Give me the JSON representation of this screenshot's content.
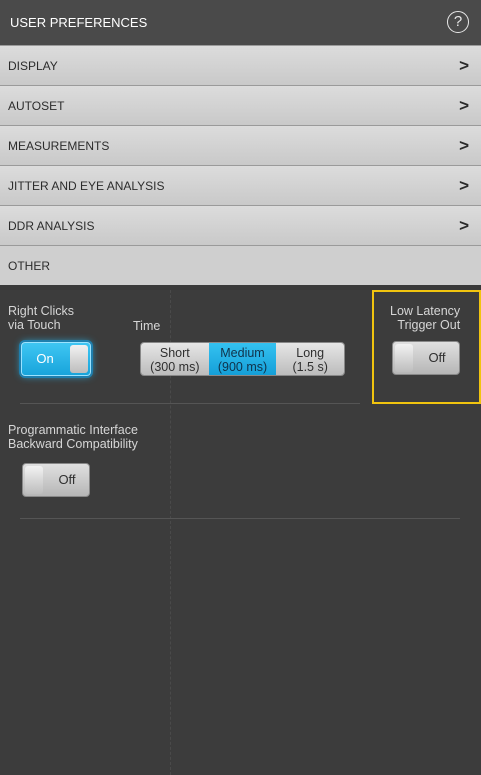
{
  "header": {
    "title": "USER PREFERENCES",
    "help_icon": "?"
  },
  "sections": [
    {
      "label": "DISPLAY",
      "expanded": false
    },
    {
      "label": "AUTOSET",
      "expanded": false
    },
    {
      "label": "MEASUREMENTS",
      "expanded": false
    },
    {
      "label": "JITTER AND EYE ANALYSIS",
      "expanded": false
    },
    {
      "label": "DDR ANALYSIS",
      "expanded": false
    },
    {
      "label": "OTHER",
      "expanded": true
    }
  ],
  "chevron": ">",
  "other": {
    "right_clicks": {
      "label_line1": "Right Clicks",
      "label_line2": "via Touch",
      "toggle_value": "On"
    },
    "time": {
      "label": "Time",
      "options": [
        {
          "line1": "Short",
          "line2": "(300 ms)",
          "selected": false
        },
        {
          "line1": "Medium",
          "line2": "(900 ms)",
          "selected": true
        },
        {
          "line1": "Long",
          "line2": "(1.5 s)",
          "selected": false
        }
      ]
    },
    "low_latency": {
      "label_line1": "Low Latency",
      "label_line2": "Trigger Out",
      "toggle_value": "Off"
    },
    "programmatic": {
      "label_line1": "Programmatic Interface",
      "label_line2": "Backward Compatibility",
      "toggle_value": "Off"
    }
  },
  "colors": {
    "accent_on": "#27b5e8",
    "highlight": "#f1c40f",
    "panel_bg": "#3c3c3c"
  }
}
